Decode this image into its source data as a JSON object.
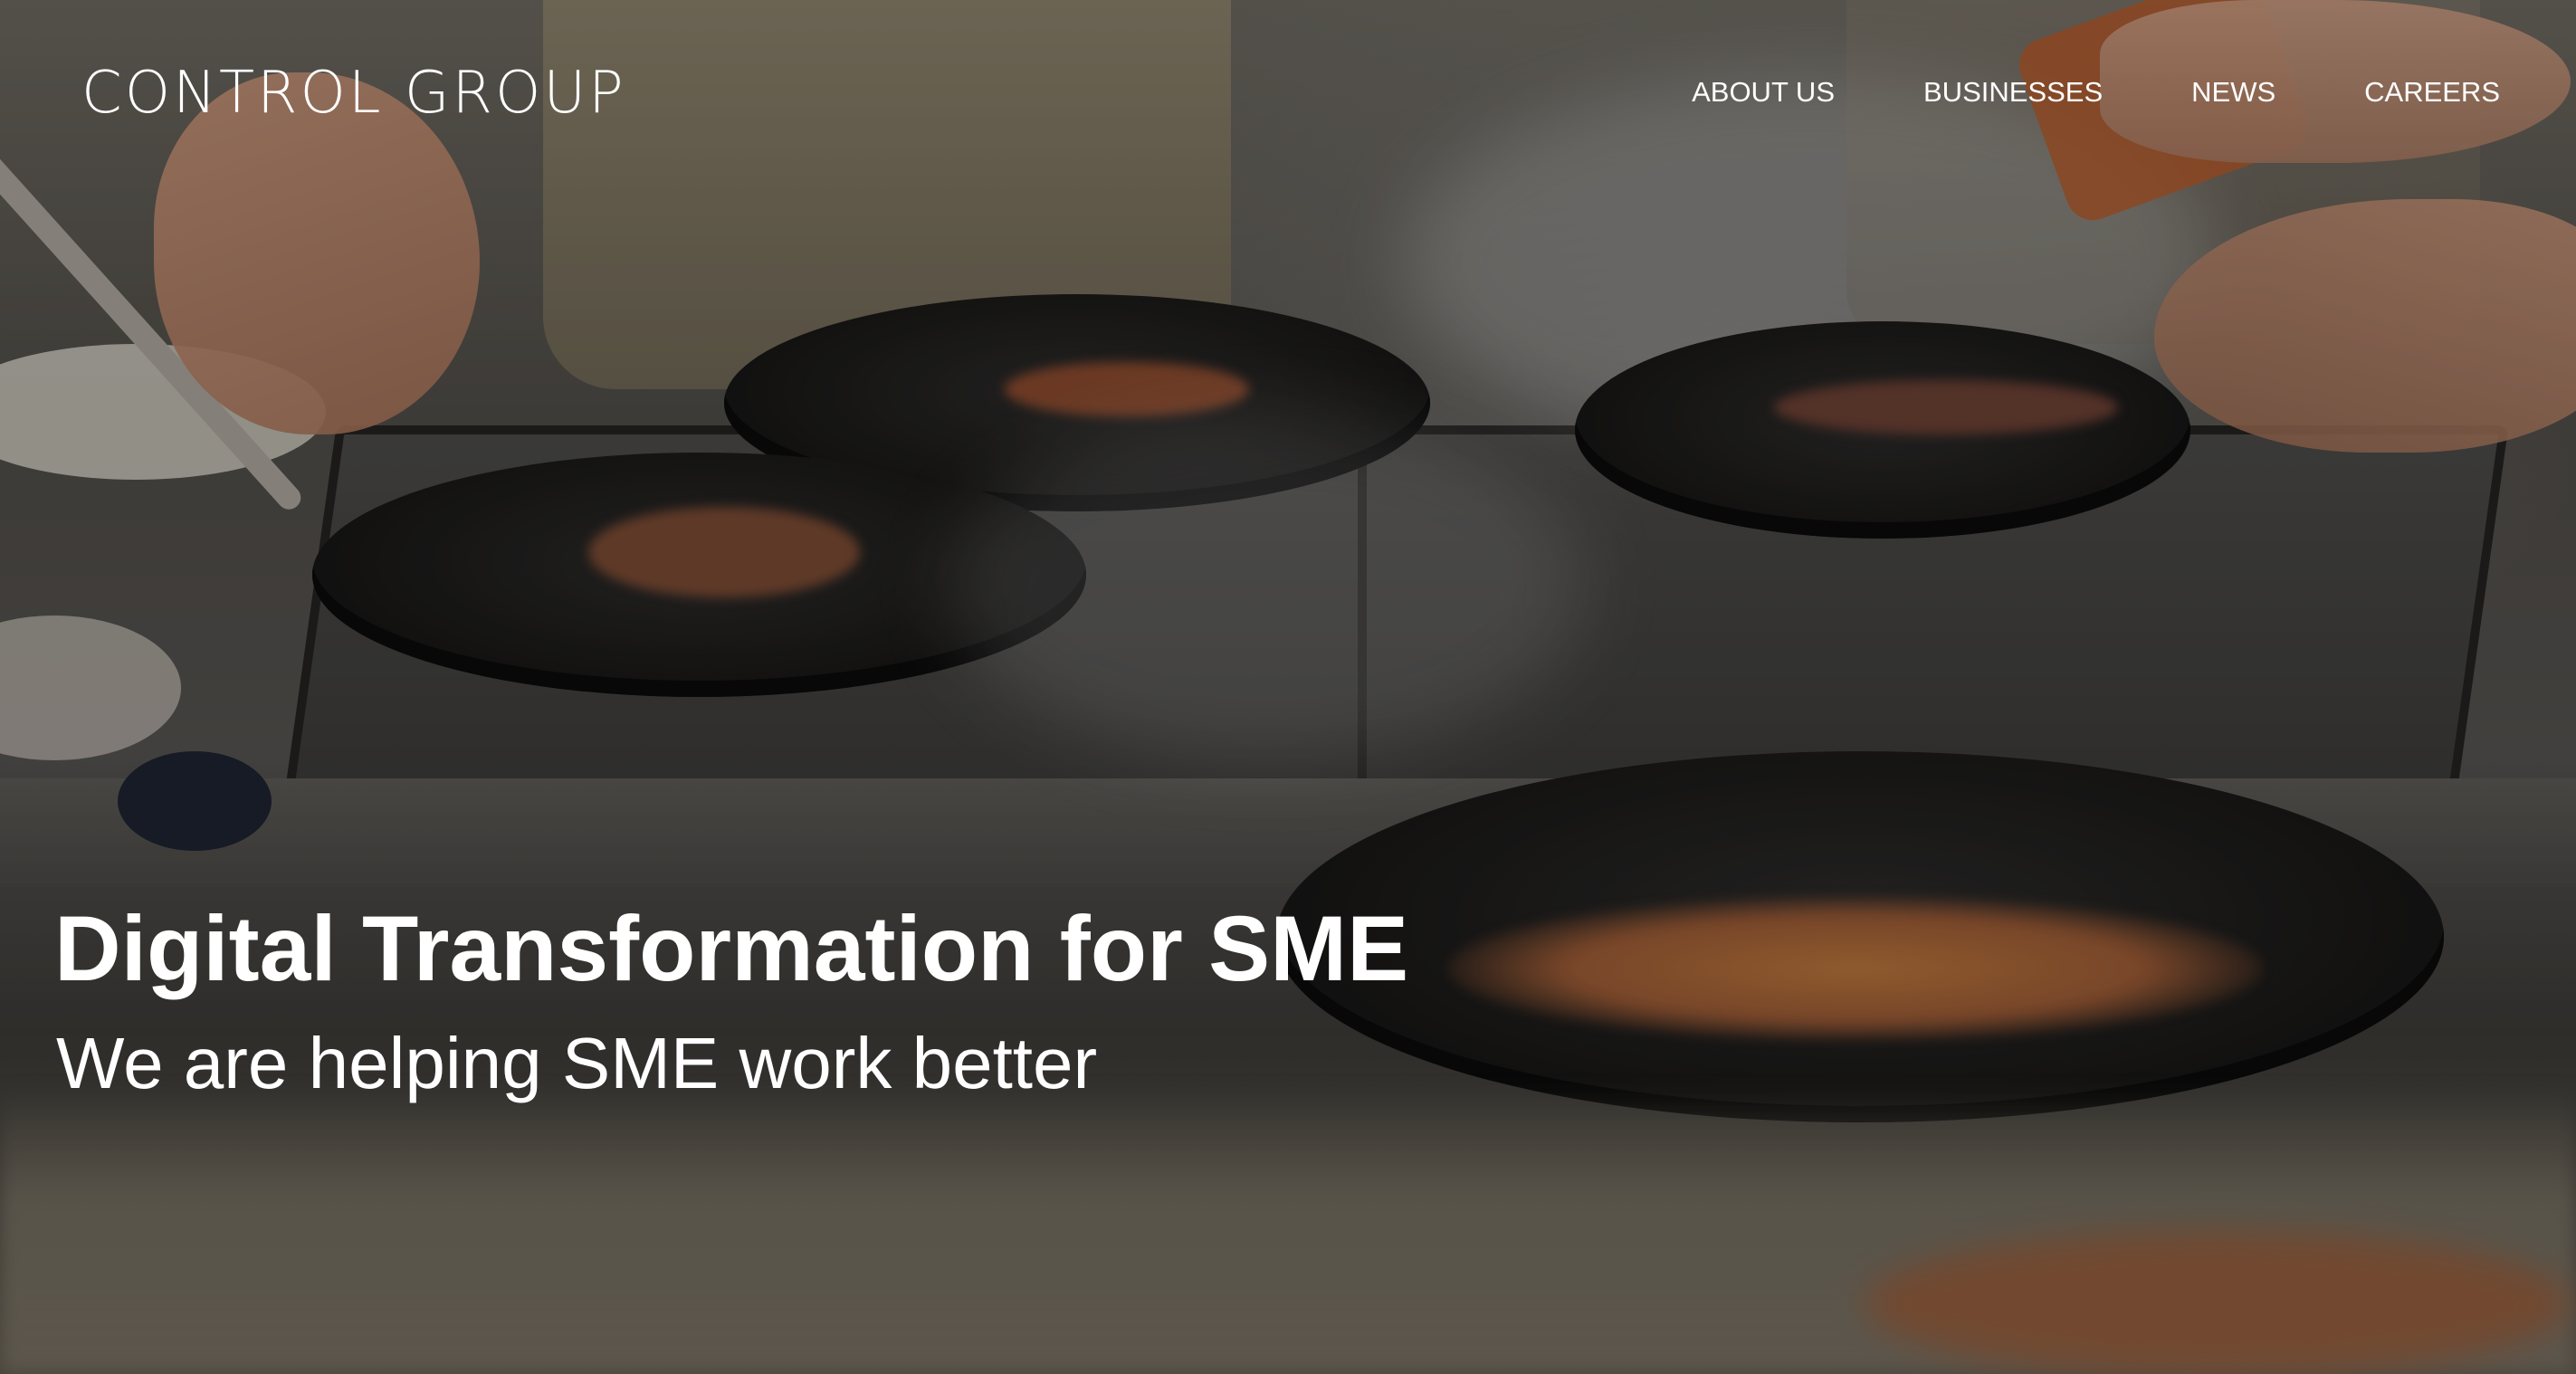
{
  "header": {
    "logo_text": "CONTROL GROUP",
    "nav": [
      {
        "label": "ABOUT US"
      },
      {
        "label": "BUSINESSES"
      },
      {
        "label": "NEWS"
      },
      {
        "label": "CAREERS"
      }
    ]
  },
  "hero": {
    "title": "Digital Transformation for SME",
    "subtitle": "We are helping SME work better",
    "background_image": "kitchen-cooking-photo"
  },
  "colors": {
    "text": "#ffffff",
    "overlay": "#000000"
  }
}
